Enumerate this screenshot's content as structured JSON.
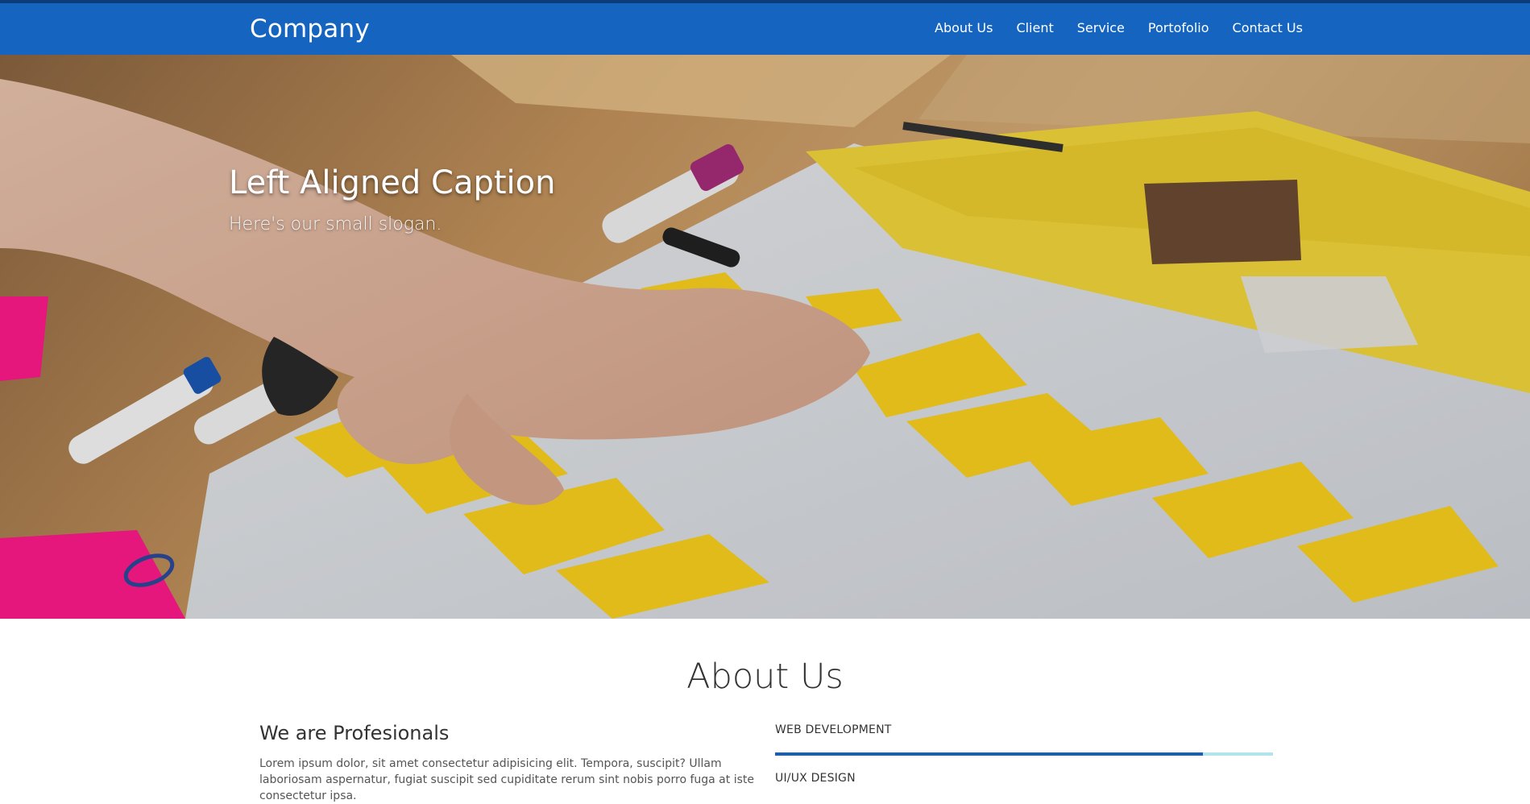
{
  "navbar": {
    "brand": "Company",
    "links": [
      "About Us",
      "Client",
      "Service",
      "Portofolio",
      "Contact Us"
    ]
  },
  "hero": {
    "caption_title": "Left Aligned Caption",
    "caption_slogan": "Here's our small slogan."
  },
  "about": {
    "title": "About Us",
    "heading": "We are Profesionals",
    "text": "Lorem ipsum dolor, sit amet consectetur adipisicing elit. Tempora, suscipit? Ullam laboriosam aspernatur, fugiat suscipit sed cupiditate rerum sint nobis porro fuga at iste consectetur ipsa.",
    "skills": [
      {
        "label": "WEB DEVELOPMENT",
        "progress": 0.86
      },
      {
        "label": "UI/UX DESIGN",
        "progress": null
      }
    ]
  },
  "colors": {
    "navbar": "#1565c0",
    "progress_fill": "#1a5fa8",
    "progress_track": "#b2e4ec"
  }
}
